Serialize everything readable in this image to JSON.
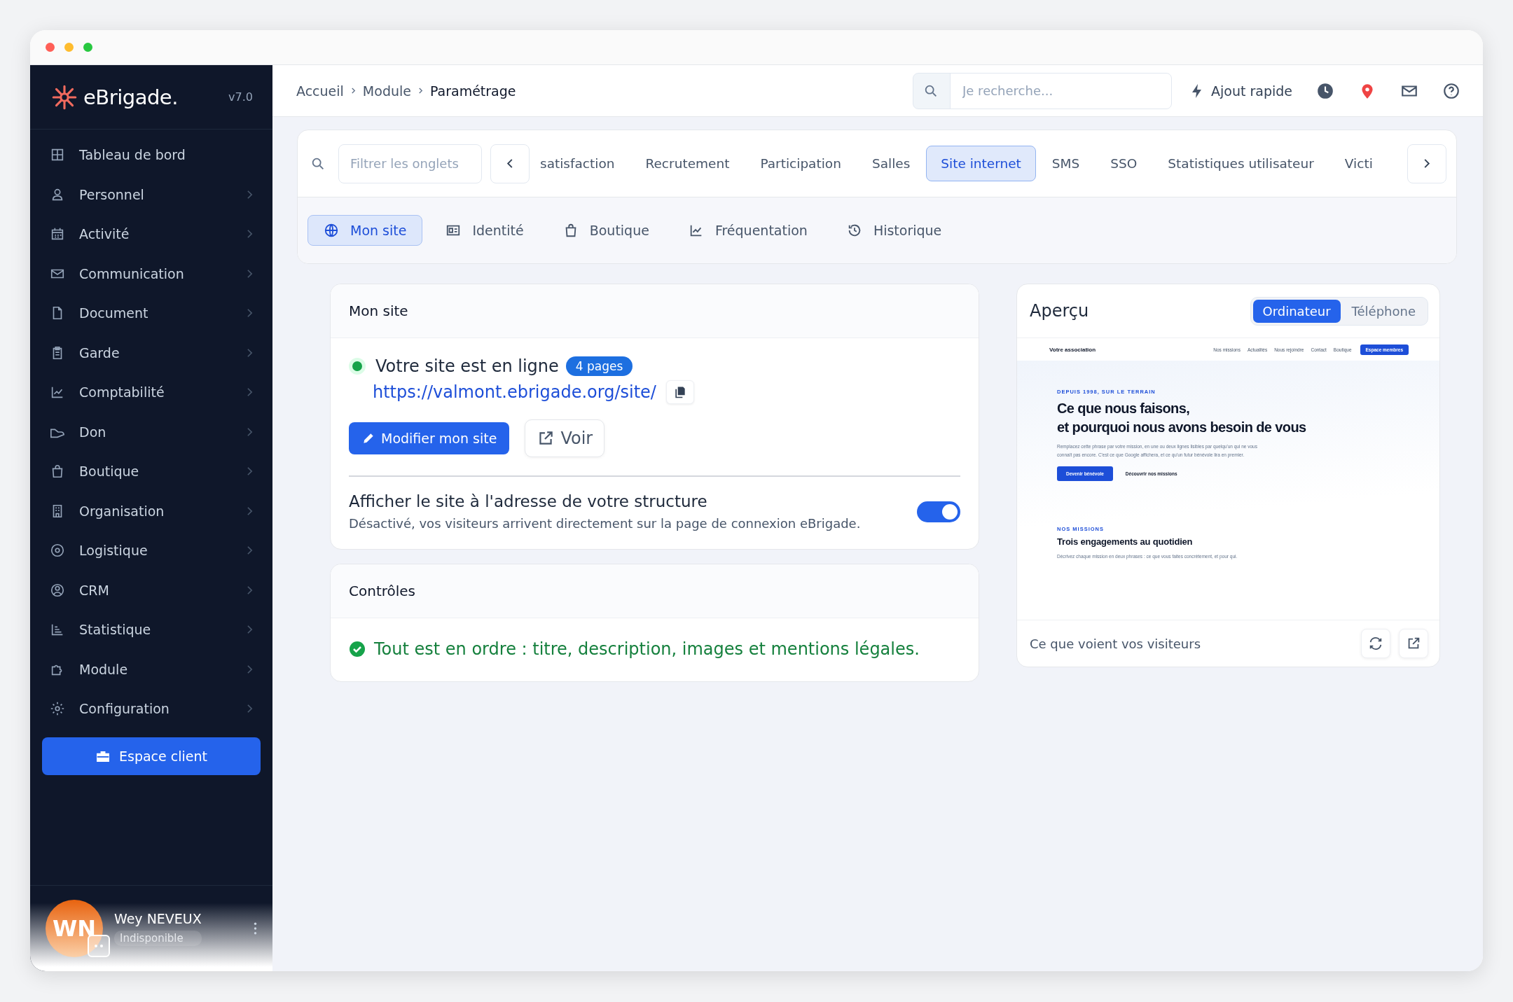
{
  "sidebar": {
    "logo": "eBrigade.",
    "version": "v7.0",
    "items": [
      {
        "label": "Tableau de bord",
        "submenu": false
      },
      {
        "label": "Personnel",
        "submenu": true
      },
      {
        "label": "Activité",
        "submenu": true
      },
      {
        "label": "Communication",
        "submenu": true
      },
      {
        "label": "Document",
        "submenu": true
      },
      {
        "label": "Garde",
        "submenu": true
      },
      {
        "label": "Comptabilité",
        "submenu": true
      },
      {
        "label": "Don",
        "submenu": true
      },
      {
        "label": "Boutique",
        "submenu": true
      },
      {
        "label": "Organisation",
        "submenu": true
      },
      {
        "label": "Logistique",
        "submenu": true
      },
      {
        "label": "CRM",
        "submenu": true
      },
      {
        "label": "Statistique",
        "submenu": true
      },
      {
        "label": "Module",
        "submenu": true
      },
      {
        "label": "Configuration",
        "submenu": true
      }
    ],
    "client_button": "Espace client",
    "user": {
      "initials": "WN",
      "name": "Wey NEVEUX",
      "status": "Indisponible"
    }
  },
  "topbar": {
    "breadcrumbs": [
      "Accueil",
      "Module",
      "Paramétrage"
    ],
    "search": {
      "placeholder": "Je recherche..."
    },
    "quick_add": "Ajout rapide"
  },
  "tabs": {
    "filter": {
      "placeholder": "Filtrer les onglets"
    },
    "items": [
      {
        "label": "satisfaction",
        "selected": false
      },
      {
        "label": "Recrutement",
        "selected": false
      },
      {
        "label": "Participation",
        "selected": false
      },
      {
        "label": "Salles",
        "selected": false
      },
      {
        "label": "Site internet",
        "selected": true
      },
      {
        "label": "SMS",
        "selected": false
      },
      {
        "label": "SSO",
        "selected": false
      },
      {
        "label": "Statistiques utilisateur",
        "selected": false
      },
      {
        "label": "Victi",
        "selected": false
      }
    ],
    "subtabs": [
      {
        "label": "Mon site",
        "selected": true
      },
      {
        "label": "Identité",
        "selected": false
      },
      {
        "label": "Boutique",
        "selected": false
      },
      {
        "label": "Fréquentation",
        "selected": false
      },
      {
        "label": "Historique",
        "selected": false
      }
    ]
  },
  "site_card": {
    "title": "Mon site",
    "online": true,
    "status": "Votre site est en ligne",
    "badge": "4 pages",
    "url": "https://valmont.ebrigade.org/site/",
    "edit_button": "Modifier mon site",
    "view_button": "Voir",
    "setting": {
      "title": "Afficher le site à l'adresse de votre structure",
      "description": "Désactivé, vos visiteurs arrivent directement sur la page de connexion eBrigade.",
      "on": true
    }
  },
  "controls_card": {
    "title": "Contrôles",
    "ok": true,
    "message": "Tout est en ordre : titre, description, images et mentions légales."
  },
  "preview": {
    "title": "Aperçu",
    "modes": [
      {
        "label": "Ordinateur",
        "selected": true
      },
      {
        "label": "Téléphone",
        "selected": false
      }
    ],
    "site": {
      "brand": "Votre association",
      "nav": [
        "Nos missions",
        "Actualités",
        "Nous rejoindre",
        "Contact",
        "Boutique"
      ],
      "nav_button": "Espace membres",
      "eyebrow": "DEPUIS 1998, SUR LE TERRAIN",
      "heading": [
        "Ce que nous faisons,",
        "et pourquoi nous avons besoin de vous"
      ],
      "intro": "Remplacez cette phrase par votre mission, en une ou deux lignes lisibles par quelqu'un qui ne vous connaît pas encore. C'est ce que Google affichera, et ce qu'un futur bénévole lira en premier.",
      "primary_button": "Devenir bénévole",
      "secondary_link": "Découvrir nos missions",
      "section_eyebrow": "NOS MISSIONS",
      "section_heading": "Trois engagements au quotidien",
      "section_text": "Décrivez chaque mission en deux phrases : ce que vous faites concrètement, et pour qui."
    },
    "footer": "Ce que voient vos visiteurs"
  }
}
